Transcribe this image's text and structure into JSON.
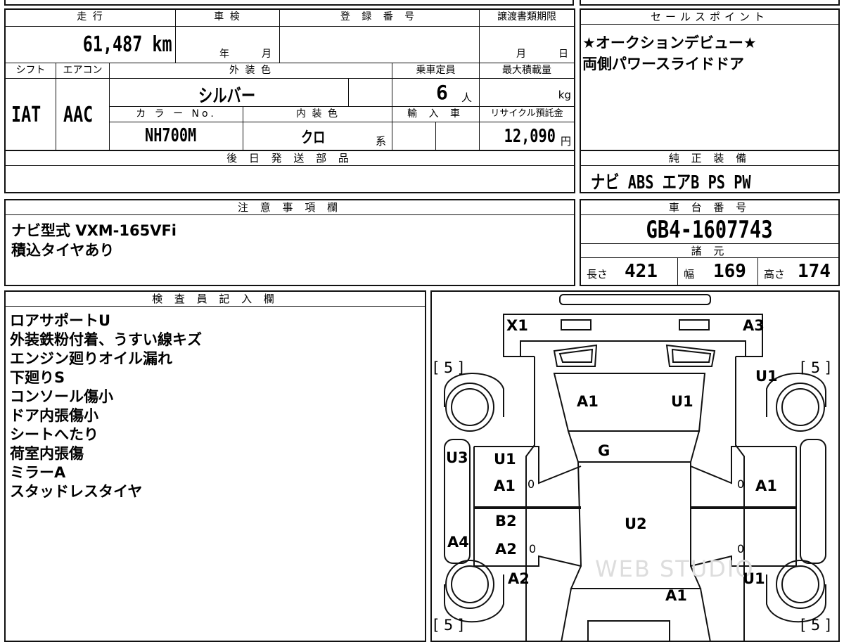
{
  "vehicle": {
    "mileage_label": "走 行",
    "mileage": "61,487 km",
    "inspection_label": "車 検",
    "inspection_year": "年",
    "inspection_month": "月",
    "registration_label": "登 録 番 号",
    "transfer_label": "譲渡書類期限",
    "transfer_month": "月",
    "transfer_day": "日",
    "shift_label": "シフト",
    "shift": "IAT",
    "ac_label": "エアコン",
    "ac": "AAC",
    "exterior_label": "外 装 色",
    "exterior_color": "シルバー",
    "capacity_label": "乗車定員",
    "capacity": "6",
    "capacity_unit": "人",
    "max_load_label": "最大積載量",
    "max_load_unit": "kg",
    "color_no_label": "カ ラ ー No.",
    "color_no": "NH700M",
    "interior_label": "内 装 色",
    "interior_color": "クロ",
    "interior_suffix": "系",
    "import_label": "輸 入 車",
    "recycle_label": "リサイクル預託金",
    "recycle_fee": "12,090",
    "recycle_unit": "円"
  },
  "later_parts": {
    "label": "後 日 発 送 部 品"
  },
  "notes": {
    "label": "注 意 事 項 欄",
    "lines": [
      "ナビ型式 VXM-165VFi",
      "積込タイヤあり"
    ]
  },
  "sales": {
    "label": "セールスポイント",
    "lines": [
      "★オークションデビュー★",
      "両側パワースライドドア"
    ]
  },
  "equipment": {
    "label": "純 正 装 備",
    "value": "ナビ ABS エアB PS PW"
  },
  "chassis": {
    "label": "車 台 番 号",
    "number": "GB4-1607743",
    "specs_label": "諸 元",
    "length_label": "長さ",
    "length": "421",
    "width_label": "幅",
    "width": "169",
    "height_label": "高さ",
    "height": "174"
  },
  "inspector": {
    "label": "検 査 員 記 入 欄",
    "lines": [
      "ロアサポートU",
      "外装鉄粉付着、うすい線キズ",
      "エンジン廻りオイル漏れ",
      "下廻りS",
      "コンソール傷小",
      "ドア内張傷小",
      "シートへたり",
      "荷室内張傷",
      "ミラーA",
      "スタッドレスタイヤ"
    ]
  },
  "diagram": {
    "marks": {
      "x1": "X1",
      "a3": "A3",
      "a1_hood": "A1",
      "u1_hood": "U1",
      "g": "G",
      "u1_left_door": "U1",
      "a1_left_door": "A1",
      "u3": "U3",
      "a1_right_door": "A1",
      "b2": "B2",
      "a2_left_rear": "A2",
      "a4": "A4",
      "u2": "U2",
      "a2_left_qtr": "A2",
      "u1_right_qtr": "U1",
      "a1_rear": "A1",
      "u1_right_front": "U1"
    },
    "tire_marks": {
      "fl": "[ 5 ]",
      "fr": "[ 5 ]",
      "rl": "[ 5 ]",
      "rr": "[ 5 ]"
    },
    "zeros": [
      "0",
      "0",
      "0",
      "0"
    ],
    "watermark": "WEB STUDIO"
  }
}
